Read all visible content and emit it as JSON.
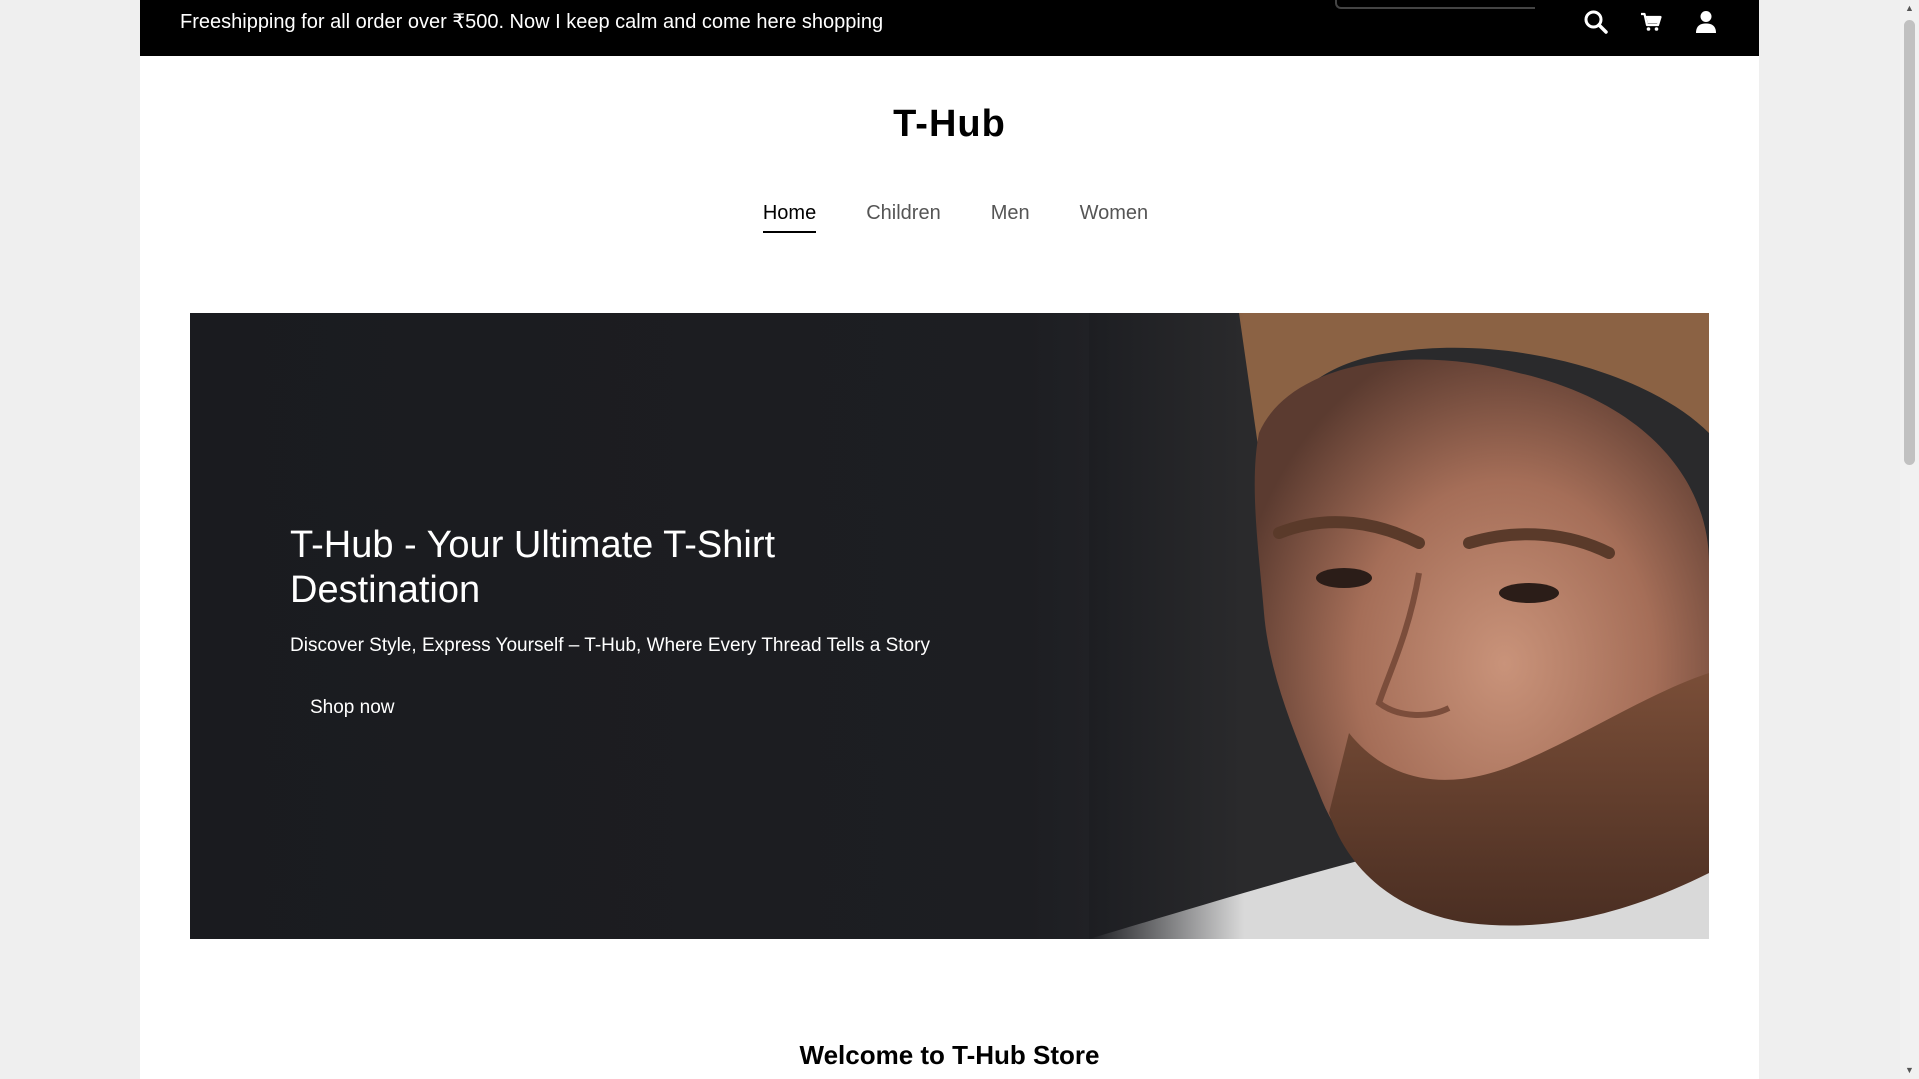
{
  "topbar": {
    "announcement": "Freeshipping for all order over ₹500. Now I keep calm and come here shopping",
    "icons": [
      "search-icon",
      "cart-icon",
      "user-icon"
    ]
  },
  "header": {
    "brand": "T-Hub"
  },
  "nav": {
    "items": [
      {
        "label": "Home",
        "active": true
      },
      {
        "label": "Children",
        "active": false
      },
      {
        "label": "Men",
        "active": false
      },
      {
        "label": "Women",
        "active": false
      }
    ]
  },
  "hero": {
    "title": "T-Hub - Your Ultimate T-Shirt Destination",
    "subtitle": "Discover Style, Express Yourself – T-Hub, Where Every Thread Tells a Story",
    "button_label": "Shop now"
  },
  "welcome": {
    "heading": "Welcome to T-Hub Store"
  },
  "colors": {
    "topbar_bg": "#000000",
    "hero_bg": "#1c1d21",
    "text": "#000000"
  }
}
